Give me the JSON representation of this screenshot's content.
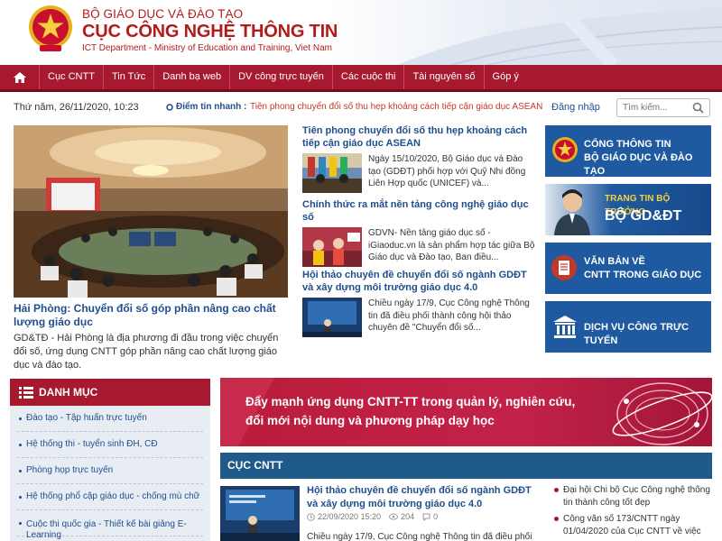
{
  "header": {
    "line1": "BỘ GIÁO DỤC VÀ ĐÀO TẠO",
    "line2": "CỤC CÔNG NGHỆ THÔNG TIN",
    "line3": "ICT Department - Ministry of Education and Training, Viet Nam"
  },
  "nav": {
    "items": [
      "Cục CNTT",
      "Tin Tức",
      "Danh bạ web",
      "DV công trực tuyến",
      "Các cuộc thi",
      "Tài nguyên số",
      "Góp ý"
    ]
  },
  "topbar": {
    "date": "Thứ năm, 26/11/2020, 10:23",
    "flash_label": "Điểm tin nhanh :",
    "flash_text": "Tiên phong chuyển đổi số thu hẹp khoảng cách tiếp cận giáo dục ASEAN",
    "login": "Đăng nhập",
    "search_placeholder": "Tìm kiếm..."
  },
  "featured": {
    "title": "Hải Phòng: Chuyển đổi số góp phần nâng cao chất lượng giáo dục",
    "desc": "GD&TĐ - Hải Phòng là địa phương đi đầu trong việc chuyển đổi số, ứng dụng CNTT góp phần nâng cao chất lượng giáo dục và đào tạo."
  },
  "news": [
    {
      "title": "Tiên phong chuyển đổi số thu hẹp khoảng cách tiếp cận giáo dục ASEAN",
      "desc": "Ngày 15/10/2020, Bộ Giáo dục và Đào tạo (GDĐT) phối hợp với Quỹ Nhi đồng Liên Hợp quốc (UNICEF) và..."
    },
    {
      "title": "Chính thức ra mắt nền tảng công nghệ giáo dục số",
      "desc": "GDVN- Nền tảng giáo dục số - iGiaoduc.vn là sản phẩm hợp tác giữa Bộ Giáo dục và Đào tạo, Ban điều..."
    },
    {
      "title": "Hội thảo chuyên đề chuyển đổi số ngành GDĐT và xây dựng môi trường giáo dục 4.0",
      "desc": "Chiều ngày 17/9, Cục Công nghệ Thông tin đã điều phối thành công hội thảo chuyên đề \"Chuyển đổi số..."
    }
  ],
  "banners": {
    "portal_line1": "CỔNG THÔNG TIN",
    "portal_line2": "BỘ GIÁO DỤC VÀ ĐÀO TẠO",
    "minister_line1": "TRANG TIN BỘ TRƯỞNG",
    "minister_line2": "BỘ GD&ĐT",
    "docs_line1": "VĂN BẢN VỀ",
    "docs_line2": "CNTT TRONG GIÁO DỤC",
    "services": "DỊCH VỤ CÔNG TRỰC TUYẾN"
  },
  "danh_muc": {
    "title": "DANH MỤC",
    "items": [
      "Đào tạo - Tập huấn trực tuyến",
      "Hệ thống thi - tuyển sinh ĐH, CĐ",
      "Phòng họp trực tuyến",
      "Hệ thống phổ cập giáo dục - chống mù chữ",
      "Cuộc thi quốc gia - Thiết kế bài giảng E-Learning"
    ]
  },
  "promo": {
    "line1": "Đẩy mạnh ứng dụng CNTT-TT trong quản lý, nghiên cứu,",
    "line2": "đổi mới nội dung và phương pháp dạy học"
  },
  "cuc_cntt": {
    "title": "CỤC CNTT",
    "article": {
      "title": "Hội thảo chuyên đề chuyển đổi số ngành GDĐT và xây dựng môi trường giáo dục 4.0",
      "date": "22/09/2020 15:20",
      "views": "204",
      "comments": "0",
      "desc": "Chiều ngày 17/9, Cục Công nghệ Thông tin đã điều phối"
    },
    "side": [
      "Đại hội Chi bộ Cục Công nghệ thông tin thành công tốt đẹp",
      "Công văn số 173/CNTT ngày 01/04/2020 của Cục CNTT về việc"
    ]
  },
  "colors": {
    "brand_red": "#a6192e",
    "brand_blue": "#1f5a8a",
    "link_blue": "#1f4e8c"
  }
}
